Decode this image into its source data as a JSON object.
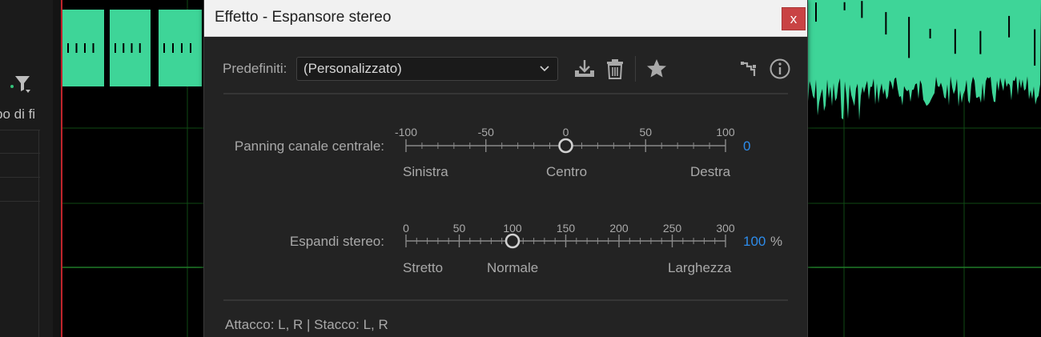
{
  "background": {
    "panel_text": "po di fi"
  },
  "dialog": {
    "title": "Effetto - Espansore stereo",
    "close_label": "x",
    "presets": {
      "label": "Predefiniti:",
      "selected": "(Personalizzato)"
    },
    "toolbar_icons": [
      "download-preset-icon",
      "trash-icon",
      "star-icon",
      "routing-icon",
      "info-icon"
    ],
    "params": [
      {
        "label": "Panning canale centrale:",
        "min": -100,
        "max": 100,
        "value": 0,
        "value_text": "0",
        "unit": "",
        "scale_labels": [
          "-100",
          "-50",
          "0",
          "50",
          "100"
        ],
        "under_labels": [
          "Sinistra",
          "Centro",
          "Destra"
        ]
      },
      {
        "label": "Espandi stereo:",
        "min": 0,
        "max": 300,
        "value": 100,
        "value_text": "100",
        "unit": "%",
        "scale_labels": [
          "0",
          "50",
          "100",
          "150",
          "200",
          "250",
          "300"
        ],
        "under_labels": [
          "Stretto",
          "Normale",
          "Larghezza"
        ]
      }
    ],
    "footer": "Attacco: L, R | Stacco: L, R"
  },
  "colors": {
    "waveform": "#3ed598",
    "playhead": "#c0252c",
    "value_blue": "#2d8ceb",
    "close_red": "#c94344"
  }
}
